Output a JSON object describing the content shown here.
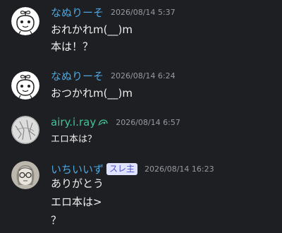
{
  "messages": [
    {
      "author": "なぬりーそ",
      "time": "2026/08/14 5:37",
      "lines": [
        "おれかれm(__)m",
        "本は！？"
      ]
    },
    {
      "author": "なぬりーそ",
      "time": "2026/08/14 6:24",
      "lines": [
        "おつかれm(__)m"
      ]
    },
    {
      "author": "airy.i.ray",
      "time": "2026/08/14 6:57",
      "lines": [
        "エロ本は？"
      ]
    },
    {
      "author": "いちいいず",
      "badge": "スレ主",
      "time": "2026/08/14 16:23",
      "lines": [
        "ありがとう",
        "エロ本は>",
        "？"
      ]
    }
  ],
  "colors": {
    "background": "#1e1f22",
    "author_blue": "#4ea6e0",
    "author_green": "#3fc496",
    "timestamp": "#969aa3",
    "badge_bg": "#e0e3ff",
    "badge_text": "#4b52c9"
  }
}
